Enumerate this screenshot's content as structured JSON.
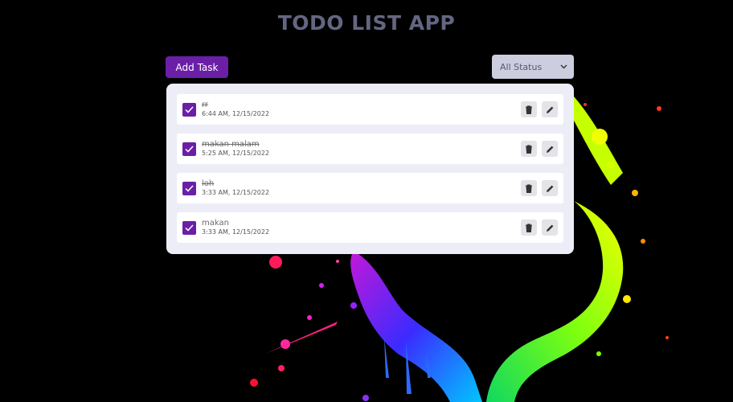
{
  "app": {
    "title": "TODO LIST APP"
  },
  "toolbar": {
    "add_label": "Add Task",
    "filter_value": "All Status"
  },
  "todos": [
    {
      "title": "rr",
      "time": "6:44 AM, 12/15/2022",
      "completed": true
    },
    {
      "title": "makan malam",
      "time": "5:25 AM, 12/15/2022",
      "completed": true
    },
    {
      "title": "loh",
      "time": "3:33 AM, 12/15/2022",
      "completed": true
    },
    {
      "title": "makan",
      "time": "3:33 AM, 12/15/2022",
      "completed": true
    }
  ],
  "colors": {
    "accent": "#6a1fa6",
    "panel": "#ecedf6",
    "title": "#646681"
  }
}
